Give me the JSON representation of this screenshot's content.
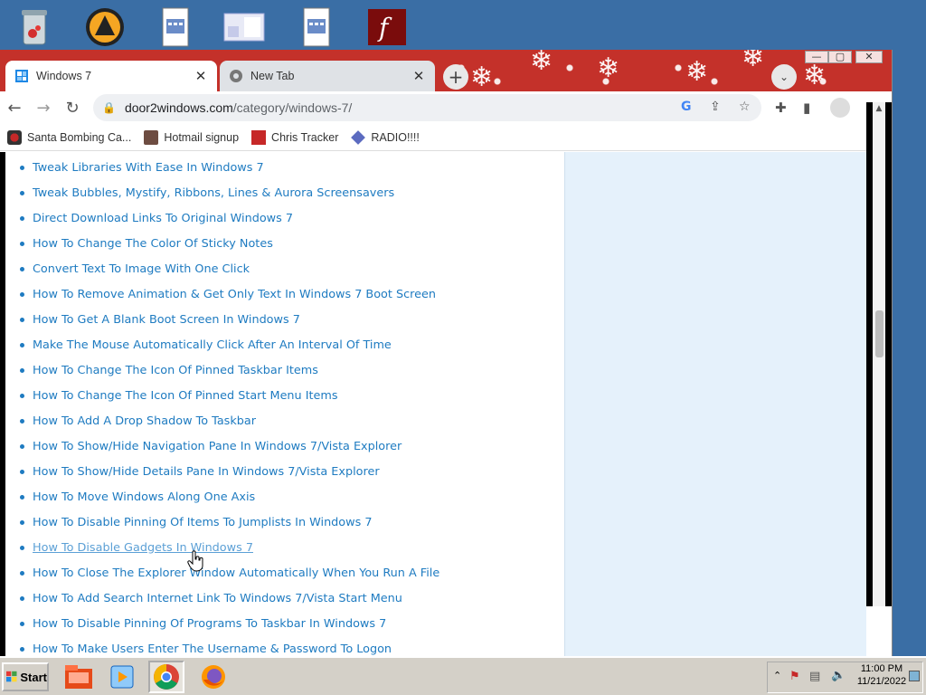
{
  "browser": {
    "tabs": [
      {
        "title": "Windows 7",
        "active": true
      },
      {
        "title": "New Tab",
        "active": false
      }
    ],
    "address": {
      "host": "door2windows.com",
      "path": "/category/windows-7/"
    },
    "bookmarks": [
      "Santa Bombing Ca...",
      "Hotmail signup",
      "Chris Tracker",
      "RADIO!!!!"
    ]
  },
  "articles": [
    "Tweak Libraries With Ease In Windows 7",
    "Tweak Bubbles, Mystify, Ribbons, Lines & Aurora Screensavers",
    "Direct Download Links To Original Windows 7",
    "How To Change The Color Of Sticky Notes",
    "Convert Text To Image With One Click",
    "How To Remove Animation & Get Only Text In Windows 7 Boot Screen",
    "How To Get A Blank Boot Screen In Windows 7",
    "Make The Mouse Automatically Click After An Interval Of Time",
    "How To Change The Icon Of Pinned Taskbar Items",
    "How To Change The Icon Of Pinned Start Menu Items",
    "How To Add A Drop Shadow To Taskbar",
    "How To Show/Hide Navigation Pane In Windows 7/Vista Explorer",
    "How To Show/Hide Details Pane In Windows 7/Vista Explorer",
    "How To Move Windows Along One Axis",
    "How To Disable Pinning Of Items To Jumplists In Windows 7",
    "How To Disable Gadgets In Windows 7",
    "How To Close The Explorer Window Automatically When You Run A File",
    "How To Add Search Internet Link To Windows 7/Vista Start Menu",
    "How To Disable Pinning Of Programs To Taskbar In Windows 7",
    "How To Make Users Enter The Username & Password To Logon"
  ],
  "hovered_article_index": 15,
  "taskbar": {
    "start_label": "Start",
    "time": "11:00 PM",
    "date": "11/21/2022"
  },
  "colors": {
    "link": "#1e7bc1",
    "sidebar_bg": "#e5f1fb",
    "titlebar": "#c4312a"
  }
}
